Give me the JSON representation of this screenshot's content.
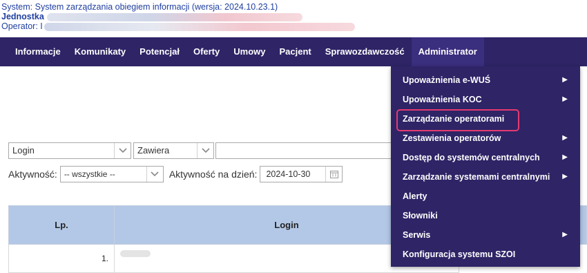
{
  "header": {
    "system_label": "System: System zarządzania obiegiem informacji",
    "version": "(wersja: 2024.10.23.1)",
    "unit_label": "Jednostka",
    "operator_label": "Operator: I"
  },
  "nav": {
    "items": [
      "Informacje",
      "Komunikaty",
      "Potencjał",
      "Oferty",
      "Umowy",
      "Pacjent",
      "Sprawozdawczość",
      "Administrator"
    ],
    "active": "Administrator"
  },
  "filters": {
    "field_select": "Login",
    "operator_select": "Zawiera",
    "search_value": "",
    "activity_label": "Aktywność:",
    "activity_value": "-- wszystkie --",
    "activity_date_label": "Aktywność na dzień:",
    "activity_date_value": "2024-10-30"
  },
  "table": {
    "columns": [
      "Lp.",
      "Login"
    ],
    "rows": [
      {
        "lp": "1."
      }
    ]
  },
  "menu": {
    "items": [
      {
        "label": "Upoważnienia e-WUŚ",
        "submenu": true
      },
      {
        "label": "Upoważnienia KOC",
        "submenu": true
      },
      {
        "label": "Zarządzanie operatorami",
        "submenu": false,
        "highlighted": true
      },
      {
        "label": "Zestawienia operatorów",
        "submenu": true
      },
      {
        "label": "Dostęp do systemów centralnych",
        "submenu": true
      },
      {
        "label": "Zarządzanie systemami centralnymi",
        "submenu": true
      },
      {
        "label": "Alerty",
        "submenu": false
      },
      {
        "label": "Słowniki",
        "submenu": false
      },
      {
        "label": "Serwis",
        "submenu": true
      },
      {
        "label": "Konfiguracja systemu SZOI",
        "submenu": false
      }
    ],
    "submenu_glyph": "▶",
    "highlight_color": "#e53a6f"
  },
  "colors": {
    "nav_bg": "#2e2466",
    "header_text": "#1f3fa0",
    "table_header_bg": "#b3c8e6"
  }
}
